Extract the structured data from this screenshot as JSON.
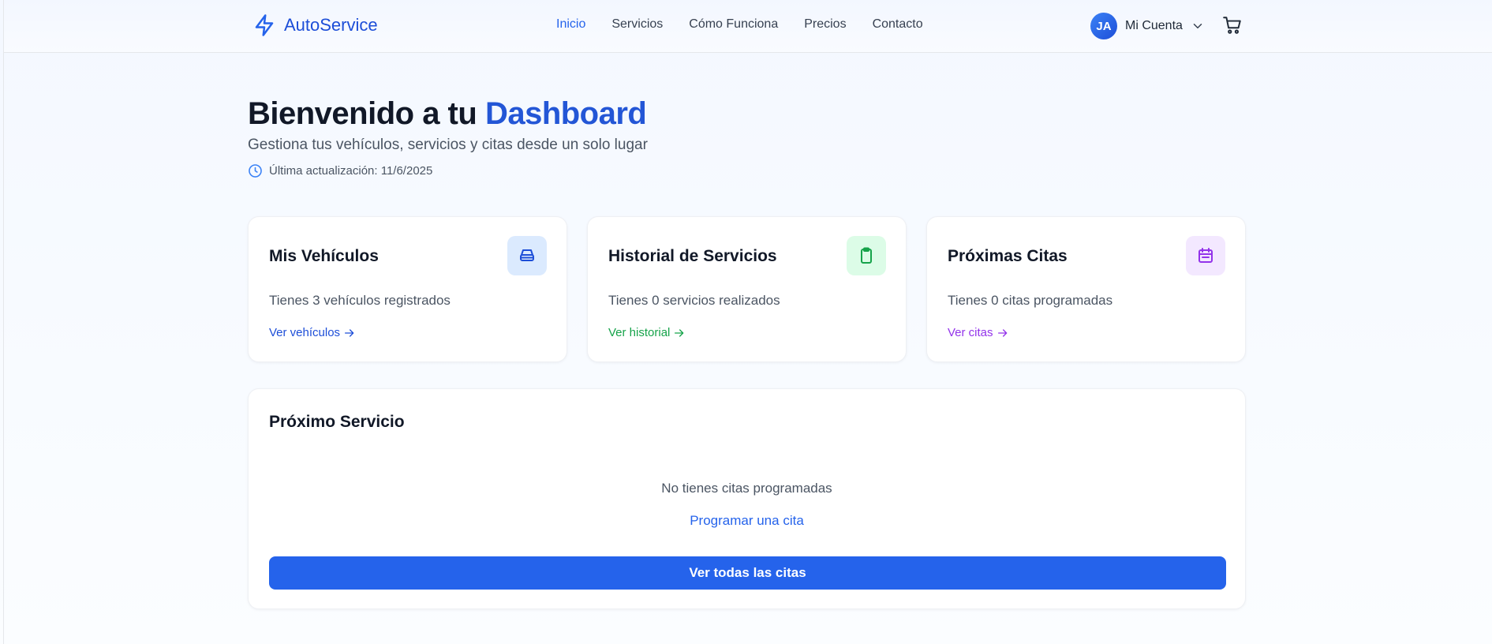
{
  "header": {
    "brand": "AutoService",
    "nav": [
      "Inicio",
      "Servicios",
      "Cómo Funciona",
      "Precios",
      "Contacto"
    ],
    "active_nav": "Inicio",
    "avatar_initials": "JA",
    "account_label": "Mi Cuenta"
  },
  "hero": {
    "title_prefix": "Bienvenido a tu ",
    "title_accent": "Dashboard",
    "subtitle": "Gestiona tus vehículos, servicios y citas desde un solo lugar",
    "updated": "Última actualización: 11/6/2025"
  },
  "cards": [
    {
      "title": "Mis Vehículos",
      "text": "Tienes 3 vehículos registrados",
      "link": "Ver vehículos",
      "icon": "car-icon",
      "color": "#1d4ed8",
      "bg": "#dbeafe"
    },
    {
      "title": "Historial de Servicios",
      "text": "Tienes 0 servicios realizados",
      "link": "Ver historial",
      "icon": "clipboard-icon",
      "color": "#16a34a",
      "bg": "#dcfce7"
    },
    {
      "title": "Próximas Citas",
      "text": "Tienes 0 citas programadas",
      "link": "Ver citas",
      "icon": "calendar-icon",
      "color": "#9333ea",
      "bg": "#f3e8ff"
    }
  ],
  "next_service": {
    "title": "Próximo Servicio",
    "empty": "No tienes citas programadas",
    "schedule_link": "Programar una cita",
    "button": "Ver todas las citas"
  },
  "colors": {
    "primary": "#2563eb",
    "brand": "#1d4ed8"
  }
}
